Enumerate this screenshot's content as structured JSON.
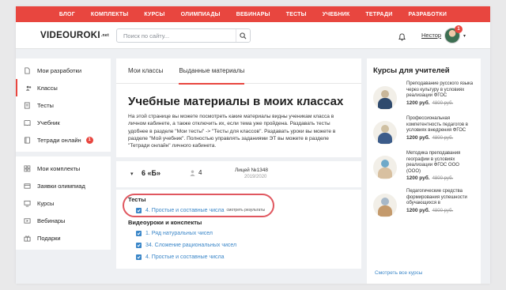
{
  "topnav": [
    "БЛОГ",
    "КОМПЛЕКТЫ",
    "КУРСЫ",
    "ОЛИМПИАДЫ",
    "ВЕБИНАРЫ",
    "ТЕСТЫ",
    "УЧЕБНИК",
    "ТЕТРАДИ",
    "РАЗРАБОТКИ"
  ],
  "header": {
    "logo": "VIDEOUROKI",
    "logo_suffix": ".net",
    "search_placeholder": "Поиск по сайту...",
    "username": "Нестор",
    "avatar_badge": "1"
  },
  "sidebar": {
    "group1": [
      {
        "label": "Мои разработки",
        "icon": "document-icon"
      },
      {
        "label": "Классы",
        "icon": "class-icon",
        "active": true
      },
      {
        "label": "Тесты",
        "icon": "test-icon"
      },
      {
        "label": "Учебник",
        "icon": "textbook-icon"
      },
      {
        "label": "Тетради онлайн",
        "icon": "notebook-icon",
        "count": "1"
      }
    ],
    "group2": [
      {
        "label": "Мои комплекты",
        "icon": "kit-icon"
      },
      {
        "label": "Заявки олимпиад",
        "icon": "olympiad-icon"
      },
      {
        "label": "Курсы",
        "icon": "courses-icon"
      },
      {
        "label": "Вебинары",
        "icon": "webinar-icon"
      },
      {
        "label": "Подарки",
        "icon": "gift-icon"
      }
    ]
  },
  "main": {
    "tabs": [
      {
        "label": "Мои классы",
        "active": false
      },
      {
        "label": "Выданные материалы",
        "active": true
      }
    ],
    "title": "Учебные материалы в моих классах",
    "description": "На этой странице вы можете посмотреть какие материалы видны ученикам класса в личном кабинете, а также отключить их, если тема уже пройдена. Раздавать тесты удобнее в разделе \"Мои тесты\" -> \"Тесты для классов\". Раздавать уроки вы можете в разделе \"Мой учебник\". Полностью управлять заданиями ЭТ вы можете в разделе \"Тетради онлайн\" личного кабинета.",
    "class_row": {
      "name": "6 «Б»",
      "pupils": "4",
      "school": "Лицей №1348",
      "year": "2019/2020"
    },
    "tests_heading": "Тесты",
    "tests": [
      {
        "label": "4. Простые и составные числа",
        "extra": "смотреть результаты"
      }
    ],
    "videos_heading": "Видеоуроки и конспекты",
    "videos": [
      {
        "label": "1. Ряд натуральных чисел"
      },
      {
        "label": "34. Сложение рациональных чисел"
      },
      {
        "label": "4. Простые и составные числа"
      }
    ]
  },
  "right": {
    "title": "Курсы для учителей",
    "courses": [
      {
        "title": "Преподавание русского языка через культуру в условиях реализации ФГОС",
        "price": "1200 руб.",
        "old_price": "4800 руб."
      },
      {
        "title": "Профессиональная компетентность педагогов в условиях внедрения ФГОС",
        "price": "1200 руб.",
        "old_price": "4800 руб."
      },
      {
        "title": "Методика преподавания географии в условиях реализации ФГОС ООО (ООО)",
        "price": "1200 руб.",
        "old_price": "4800 руб."
      },
      {
        "title": "Педагогические средства формирования успешности обучающихся в",
        "price": "1200 руб.",
        "old_price": "4800 руб."
      }
    ],
    "all_link": "Смотреть все курсы"
  },
  "colors": {
    "accent": "#e8463f",
    "link": "#3a86c8"
  }
}
